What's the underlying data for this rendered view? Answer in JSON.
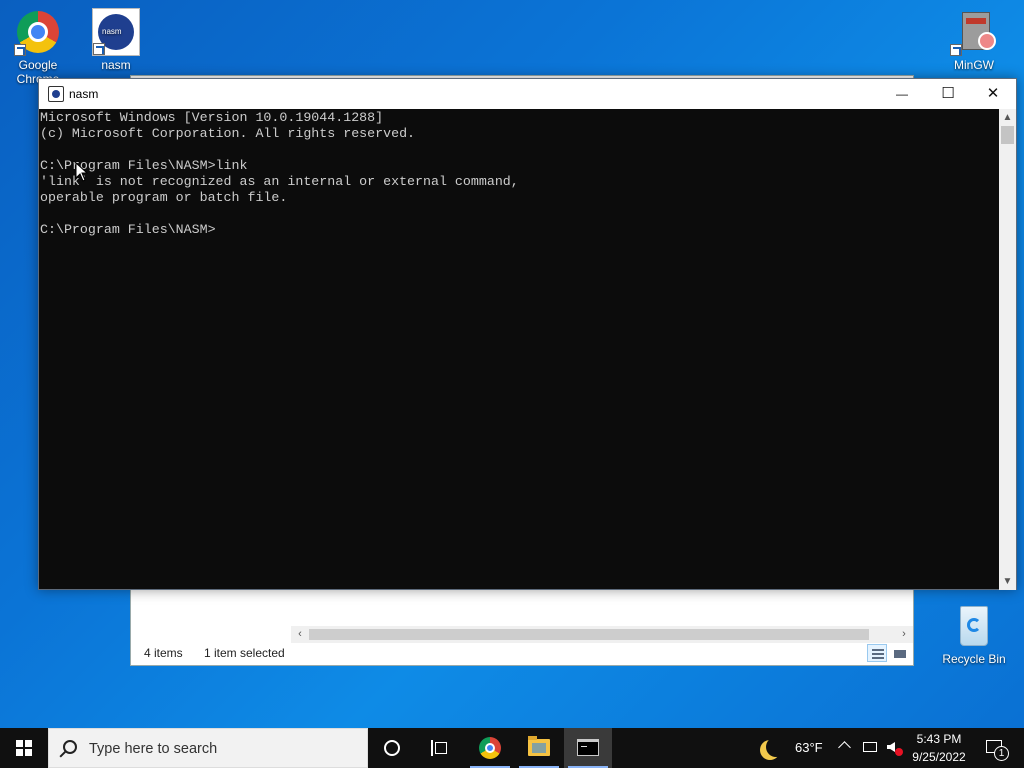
{
  "desktop": {
    "icons": [
      {
        "label": "Google Chrome"
      },
      {
        "label": "nasm"
      },
      {
        "label": "MinGW Installer"
      },
      {
        "label": "Recycle Bin"
      }
    ]
  },
  "explorer": {
    "status_items": "4 items",
    "status_selected": "1 item selected"
  },
  "cmd_window": {
    "title": "nasm",
    "lines": [
      "Microsoft Windows [Version 10.0.19044.1288]",
      "(c) Microsoft Corporation. All rights reserved.",
      "",
      "C:\\Program Files\\NASM>link",
      "'link' is not recognized as an internal or external command,",
      "operable program or batch file.",
      "",
      "C:\\Program Files\\NASM>"
    ],
    "minimize_glyph": "—",
    "maximize_glyph": "☐",
    "close_glyph": "✕"
  },
  "taskbar": {
    "search_placeholder": "Type here to search",
    "weather": "63°F",
    "time": "5:43 PM",
    "date": "9/25/2022",
    "notification_count": "1",
    "pinned": [
      "cortana-icon",
      "task-view-icon",
      "chrome-icon",
      "file-explorer-icon",
      "command-prompt-icon"
    ]
  },
  "colors": {
    "console_bg": "#0c0c0c",
    "console_fg": "#cccccc",
    "taskbar_bg": "#101010",
    "desktop_blue": "#0b74d6"
  }
}
